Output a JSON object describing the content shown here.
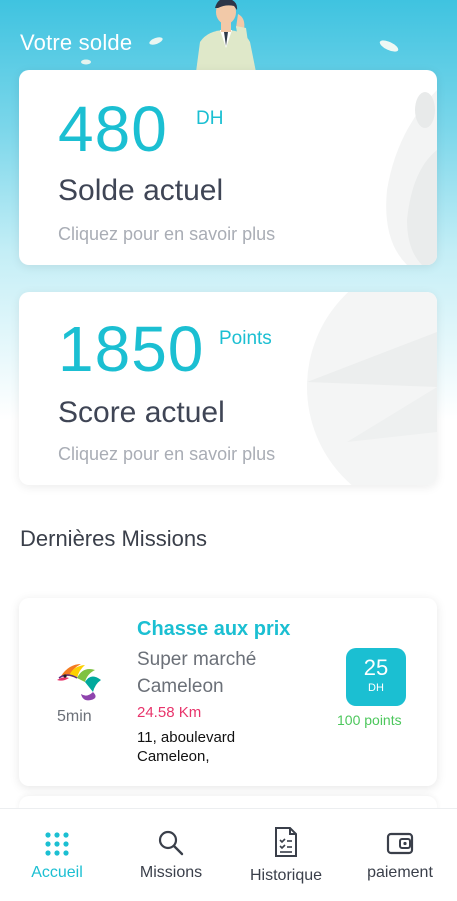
{
  "header": {
    "title": "Votre solde"
  },
  "balance_card": {
    "amount": "480",
    "unit": "DH",
    "label": "Solde actuel",
    "link": "Cliquez pour en savoir plus"
  },
  "score_card": {
    "amount": "1850",
    "unit": "Points",
    "label": "Score actuel",
    "link": "Cliquez pour en savoir plus"
  },
  "missions_section": {
    "title": "Dernières Missions",
    "items": [
      {
        "title": "Chasse aux prix",
        "store": "Super marché Cameleon",
        "distance": "24.58 Km",
        "address": "11, aboulevard Cameleon,",
        "duration": "5min",
        "reward_amount": "25",
        "reward_currency": "DH",
        "reward_points": "100 points",
        "logo": "chameleon-logo-icon"
      }
    ]
  },
  "bottom_nav": {
    "items": [
      {
        "label": "Accueil",
        "icon": "grid-icon",
        "active": true
      },
      {
        "label": "Missions",
        "icon": "search-icon",
        "active": false
      },
      {
        "label": "Historique",
        "icon": "document-list-icon",
        "active": false
      },
      {
        "label": "paiement",
        "icon": "wallet-icon",
        "active": false
      }
    ]
  },
  "colors": {
    "accent": "#1bbfd2",
    "header_gradient_top": "#3fc3e0",
    "distance": "#e8346b",
    "points": "#4cc75c"
  }
}
